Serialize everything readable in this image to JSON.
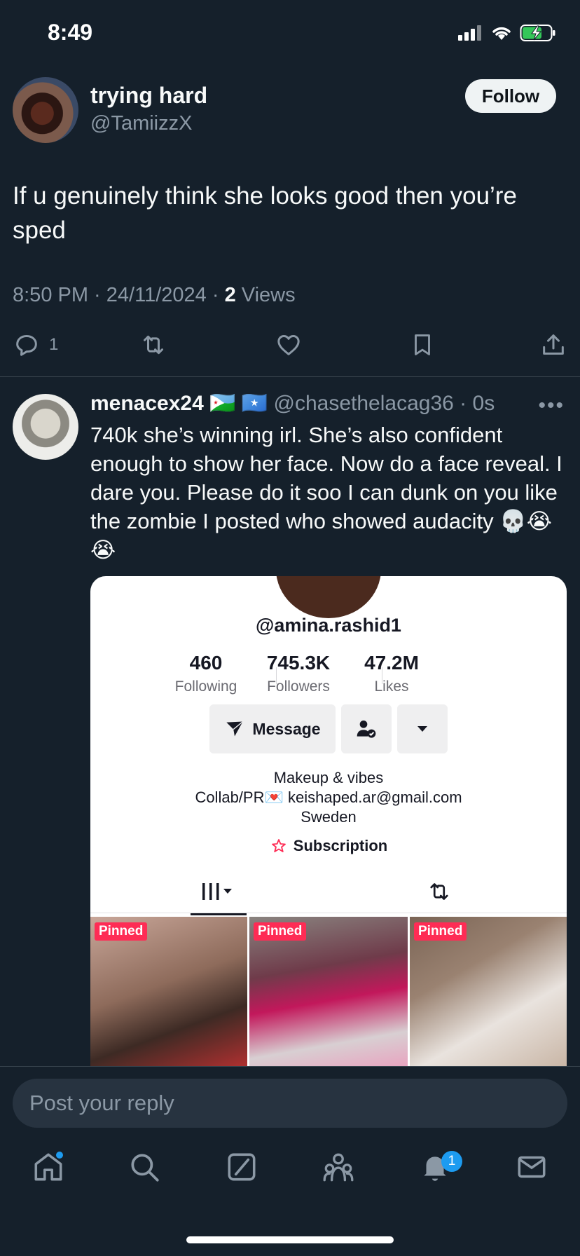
{
  "status_bar": {
    "time": "8:49"
  },
  "tweet": {
    "author_name": "trying hard",
    "author_handle": "@TamiizzX",
    "follow_label": "Follow",
    "text": "If u genuinely think she looks good then you’re sped",
    "time": "8:50 PM",
    "date": "24/11/2024",
    "views_count": "2",
    "views_label": "Views",
    "reply_count": "1"
  },
  "reply": {
    "author_name": "menacex24",
    "flags": "🇩🇯 🇸🇴",
    "author_handle": "@chasethelacag36",
    "time": "0s",
    "text": "740k she’s winning irl. She’s also confident enough to show her face. Now do a face reveal. I dare you. Please do it soo I can dunk on you like the zombie I posted who showed audacity 💀😭😭",
    "more_label": "•••",
    "embed": {
      "username": "@amina.rashid1",
      "stats": [
        {
          "value": "460",
          "label": "Following"
        },
        {
          "value": "745.3K",
          "label": "Followers"
        },
        {
          "value": "47.2M",
          "label": "Likes"
        }
      ],
      "message_label": "Message",
      "bio_line1": "Makeup & vibes",
      "bio_line2": "Collab/PR💌 keishaped.ar@gmail.com",
      "bio_line3": "Sweden",
      "subscription_label": "Subscription",
      "thumbnails": [
        {
          "badge": "Pinned",
          "color": "#8e6b5b"
        },
        {
          "badge": "Pinned",
          "color": "#6f3b4a"
        },
        {
          "badge": "Pinned",
          "color": "#9a8271"
        }
      ]
    }
  },
  "composer": {
    "placeholder": "Post your reply"
  },
  "tabbar": {
    "notification_count": "1"
  },
  "colors": {
    "background": "#15202b",
    "accent": "#1d9bf0",
    "muted": "#8b98a5"
  }
}
